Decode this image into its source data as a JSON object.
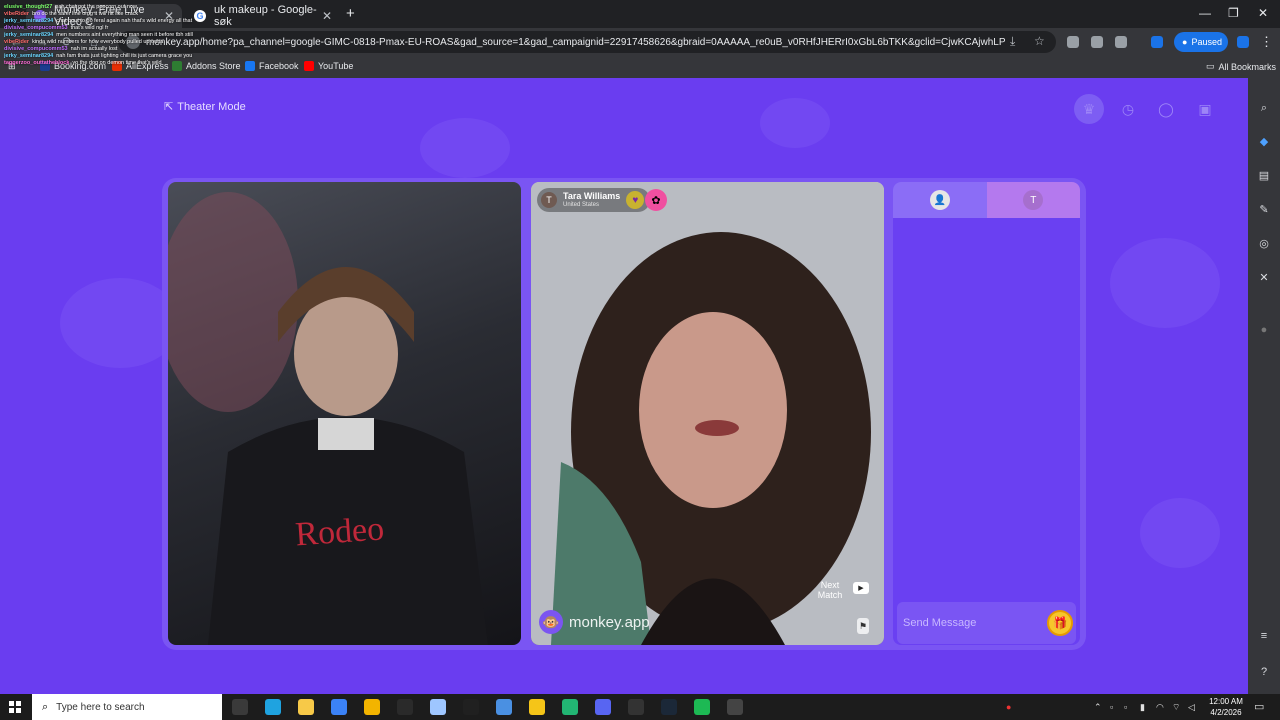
{
  "browser": {
    "tabs": [
      {
        "title": "Monkey: Free Live Video C",
        "close": "✕"
      },
      {
        "title": "uk makeup - Google-søk",
        "close": "✕"
      }
    ],
    "new_tab": "+",
    "window_controls": {
      "minimize": "—",
      "maximize": "❐",
      "close": "✕"
    },
    "nav": {
      "back": "←",
      "forward": "→",
      "reload": "⟳"
    },
    "url": "monkey.app/home?pa_channel=google-GIMC-0818-Pmax-EU-ROAS&gad_source=1&gad_campaignid=22917458626&gbraid=0AAAAA_re0uB_v0RHfJHERrI0xGbL6bTKK&gclid=CjwKCAjwhLPOBhBiEiwA8_wJH...",
    "profile_label": "Paused",
    "menu": "⋮",
    "bookmarks": [
      {
        "label": "Booking.com",
        "color": "#1a3c8f"
      },
      {
        "label": "AliExpress",
        "color": "#e62e04"
      },
      {
        "label": "Addons Store",
        "color": "#2e7d32"
      },
      {
        "label": "Facebook",
        "color": "#1877f2"
      },
      {
        "label": "YouTube",
        "color": "#ff0000"
      }
    ],
    "all_bookmarks": "All Bookmarks"
  },
  "chat_overlay": [
    {
      "user": "elusive_thought27",
      "text": "nah chat got the popcorn out now",
      "color": "#7cff6b"
    },
    {
      "user": "vibeRider",
      "text": "bro do the safer line omg it will hit like crack",
      "color": "#ff6b6b"
    },
    {
      "user": "jerky_seminar8294",
      "text": "chat bout to go feral again nah that's wild energy all that",
      "color": "#6bd6ff"
    },
    {
      "user": "divisive_compucomm53",
      "text": "that's wild ngl fr",
      "color": "#c06bff"
    },
    {
      "user": "jerky_seminar8294",
      "text": "men numbers aint everything man seen it before tbh still",
      "color": "#6bd6ff"
    },
    {
      "user": "vibeRider",
      "text": "kinda wild numbers for how everybody pulled up outta",
      "color": "#ff6b6b"
    },
    {
      "user": "divisive_compucomm53",
      "text": "nah im actually lost",
      "color": "#c06bff"
    },
    {
      "user": "jerky_seminar8294",
      "text": "nah fam thats just lighting chill its just camera grace you",
      "color": "#6bd6ff"
    },
    {
      "user": "taggerzoo_outtatheblock",
      "text": "yo the dog on demon time that's wild",
      "color": "#ff6bd6"
    }
  ],
  "site": {
    "theater_mode": "Theater Mode",
    "top_icons": [
      "crown-icon",
      "clock-icon",
      "chat-bubble-icon",
      "gift-box-icon"
    ],
    "partner": {
      "name": "Tara Williams",
      "country": "United States",
      "avatar_initial": "T"
    },
    "next_match": "Next Match",
    "watermark": "monkey.app",
    "chat": {
      "self_initial": "👤",
      "partner_initial": "T",
      "placeholder": "Send Message",
      "gift_symbol": "🎁"
    }
  },
  "taskbar": {
    "search_placeholder": "Type here to search",
    "time": "12:00 AM",
    "date": "4/2/2026",
    "apps": [
      {
        "name": "task-view",
        "color": "#3a3a3a"
      },
      {
        "name": "edge",
        "color": "#1fa3e0"
      },
      {
        "name": "file-explorer",
        "color": "#f7c948"
      },
      {
        "name": "store",
        "color": "#3b82f6"
      },
      {
        "name": "chrome",
        "color": "#f3b400"
      },
      {
        "name": "app-dark",
        "color": "#2a2a2a"
      },
      {
        "name": "photos",
        "color": "#9ec6ff"
      },
      {
        "name": "obs",
        "color": "#202020"
      },
      {
        "name": "app-blue",
        "color": "#4a90e2"
      },
      {
        "name": "app-yellow",
        "color": "#f5c518"
      },
      {
        "name": "app-green",
        "color": "#22b573"
      },
      {
        "name": "discord",
        "color": "#5865f2"
      },
      {
        "name": "epic",
        "color": "#333333"
      },
      {
        "name": "steam",
        "color": "#1b2838"
      },
      {
        "name": "spotify",
        "color": "#1db954"
      },
      {
        "name": "settings",
        "color": "#444444"
      }
    ]
  },
  "colors": {
    "brand": "#6a3df0",
    "panel": "#7a55f3",
    "gift": "#f6c62b"
  }
}
